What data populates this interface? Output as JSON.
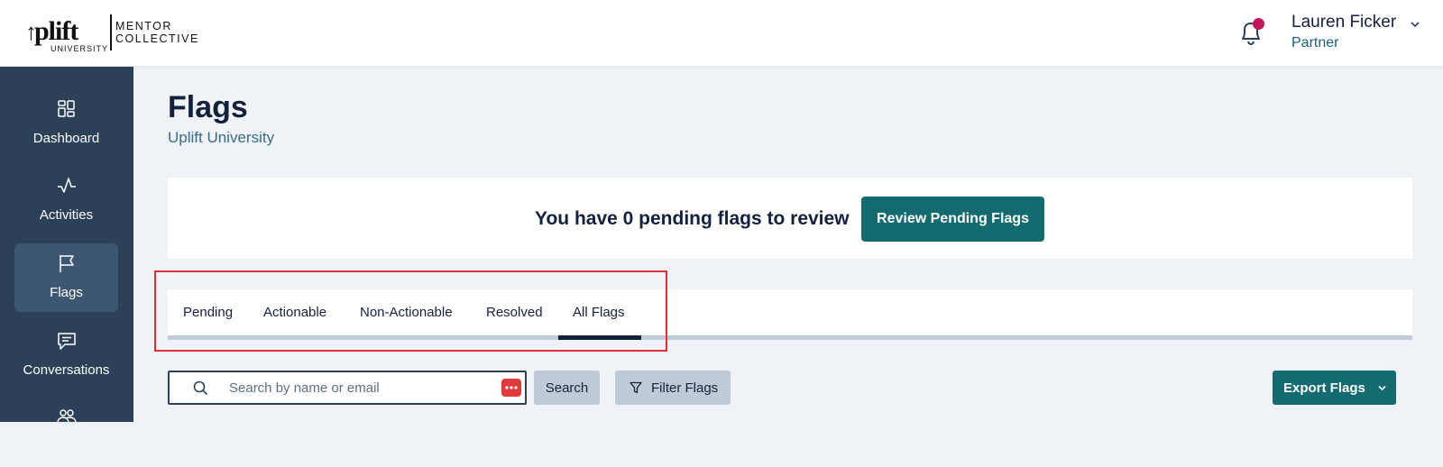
{
  "brand": {
    "logo_main": "plift",
    "logo_arrow": "↑",
    "logo_sub": "UNIVERSITY",
    "partner_line1": "MENTOR",
    "partner_line2": "COLLECTIVE"
  },
  "user": {
    "name": "Lauren Ficker",
    "role": "Partner"
  },
  "colors": {
    "sidebar": "#2c4158",
    "accent": "#136b70",
    "notification_dot": "#c2185b",
    "highlight": "#e03131"
  },
  "sidebar": {
    "items": [
      {
        "label": "Dashboard",
        "icon": "dashboard-icon",
        "active": false
      },
      {
        "label": "Activities",
        "icon": "activity-icon",
        "active": false
      },
      {
        "label": "Flags",
        "icon": "flag-icon",
        "active": true
      },
      {
        "label": "Conversations",
        "icon": "chat-icon",
        "active": false
      },
      {
        "label": "",
        "icon": "people-icon",
        "active": false
      }
    ]
  },
  "page": {
    "title": "Flags",
    "subtitle": "Uplift University"
  },
  "pending": {
    "message": "You have 0 pending flags to review",
    "button_label": "Review Pending Flags"
  },
  "tabs": {
    "items": [
      "Pending",
      "Actionable",
      "Non-Actionable",
      "Resolved",
      "All Flags"
    ],
    "selected": "All Flags"
  },
  "toolbar": {
    "search_placeholder": "Search by name or email",
    "search_value": "",
    "search_button": "Search",
    "filter_button": "Filter Flags",
    "export_button": "Export Flags"
  }
}
